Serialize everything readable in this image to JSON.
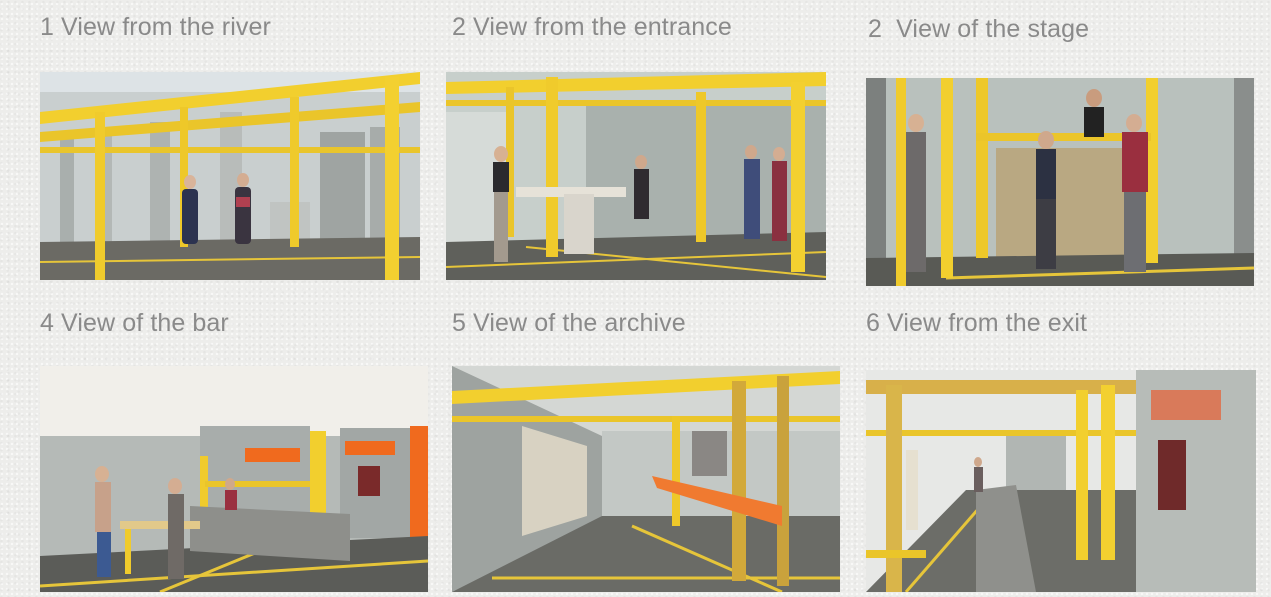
{
  "panels": [
    {
      "caption": "1 View from the river",
      "subject": "model-river"
    },
    {
      "caption": "2 View from the entrance",
      "subject": "model-entrance"
    },
    {
      "caption": "2  View of the stage",
      "subject": "model-stage"
    },
    {
      "caption": "4 View of the bar",
      "subject": "model-bar"
    },
    {
      "caption": "5 View of the archive",
      "subject": "model-archive"
    },
    {
      "caption": "6 View from the exit",
      "subject": "model-exit"
    }
  ],
  "colors": {
    "background": "#ededeb",
    "caption": "#8a8a8a",
    "yellow_structure": "#f2cf2e",
    "grey_wall": "#b8bdbb",
    "floor": "#6e6c66",
    "orange_accent": "#f06a1e"
  }
}
